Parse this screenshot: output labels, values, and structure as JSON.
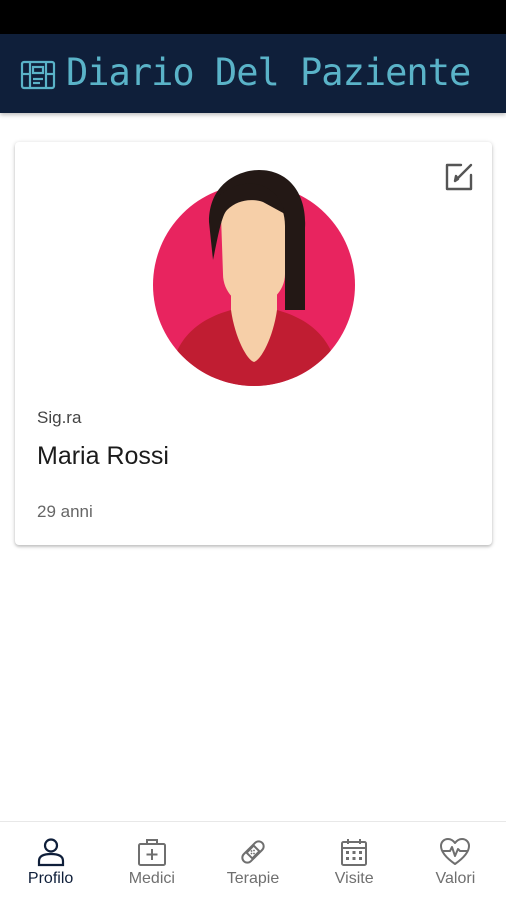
{
  "app": {
    "title": "Diario Del Paziente",
    "colors": {
      "app_bar": "#0f1f3a",
      "title": "#5ab3c8",
      "avatar_background": "#e8245f",
      "nav_active": "#0f1f3a",
      "nav_inactive": "#6f6f6f"
    }
  },
  "profile": {
    "salutation": "Sig.ra",
    "name": "Maria Rossi",
    "age": "29 anni",
    "edit_icon": "edit-square-icon",
    "avatar_icon": "female-avatar-icon"
  },
  "nav": {
    "active": "Profilo",
    "items": [
      {
        "label": "Profilo",
        "icon": "person-icon"
      },
      {
        "label": "Medici",
        "icon": "medical-bag-icon"
      },
      {
        "label": "Terapie",
        "icon": "bandage-icon"
      },
      {
        "label": "Visite",
        "icon": "calendar-icon"
      },
      {
        "label": "Valori",
        "icon": "heart-pulse-icon"
      }
    ]
  }
}
